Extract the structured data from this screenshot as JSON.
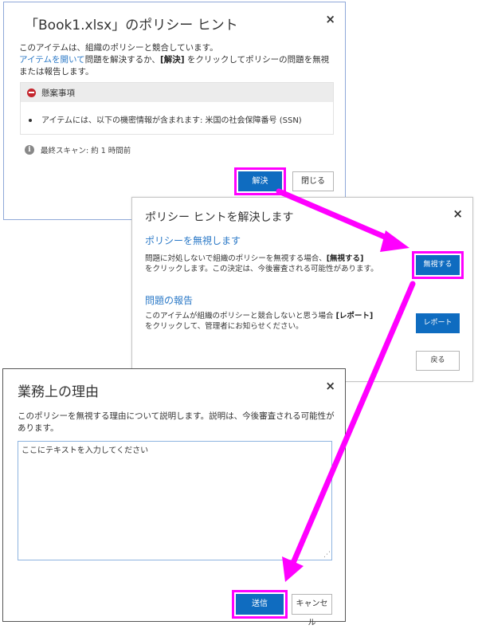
{
  "dialog1": {
    "title": "「Book1.xlsx」のポリシー ヒント",
    "line1": "このアイテムは、組織のポリシーと競合しています。",
    "open_link": "アイテムを開いて",
    "line2a": "問題を解決するか、",
    "resolve_ref": "[解決]",
    "line2b": "をクリックしてポリシーの問題を無視",
    "line3": "または報告します。",
    "concern_title": "懸案事項",
    "concern_item": "アイテムには、以下の機密情報が含まれます: 米国の社会保障番号 (SSN)",
    "last_scan": "最終スキャン: 約 1 時間前",
    "resolve_button": "解決",
    "close_button": "閉じる"
  },
  "dialog2": {
    "title": "ポリシー ヒントを解決します",
    "ignore_title": "ポリシーを無視します",
    "ignore_desc_a": "問題に対処しないで組織のポリシーを無視する場合、",
    "ignore_desc_ref": "[無視する]",
    "ignore_desc_b": "をクリックします。この決定は、今後審査される可能性があります。",
    "ignore_button": "無視する",
    "report_title": "問題の報告",
    "report_desc_a": "このアイテムが組織のポリシーと競合しないと思う場合",
    "report_desc_ref": "[レポート]",
    "report_desc_b": "をクリックして、管理者にお知らせください。",
    "report_button": "レポート",
    "back_button": "戻る"
  },
  "dialog3": {
    "title": "業務上の理由",
    "desc": "このポリシーを無視する理由について説明します。説明は、今後審査される可能性があります。",
    "textarea_value": "ここにテキストを入力してください",
    "send_button": "送信",
    "cancel_button": "キャンセル"
  },
  "close_glyph": "×",
  "colors": {
    "accent": "#0f6cc0",
    "highlight": "#ff00ff",
    "link": "#2b79c7"
  }
}
